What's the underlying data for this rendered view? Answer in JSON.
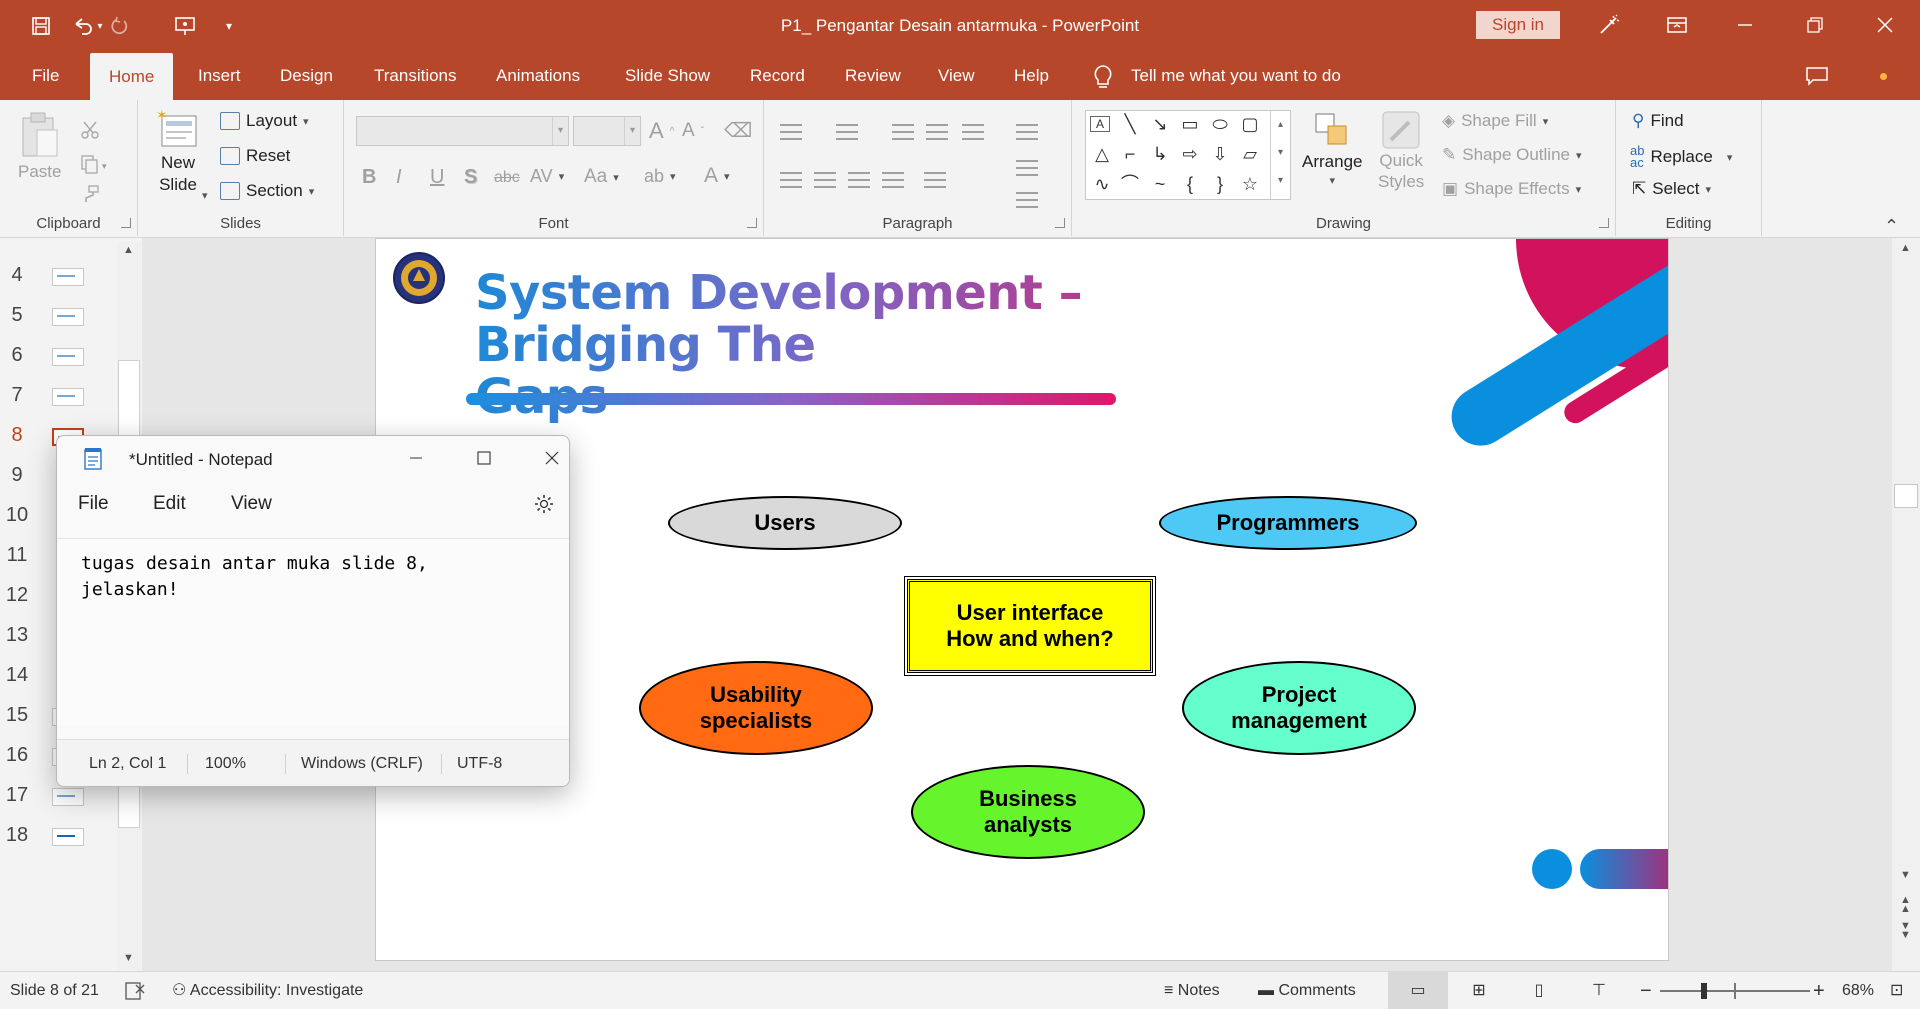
{
  "titlebar": {
    "document_title": "P1_ Pengantar Desain antarmuka  -  PowerPoint",
    "signin_label": "Sign in",
    "quick_access": [
      "save-icon",
      "undo-icon",
      "redo-icon",
      "present-icon",
      "customize-icon"
    ],
    "window_controls": [
      "ribbon-display-icon",
      "minimize-icon",
      "restore-icon",
      "close-icon"
    ]
  },
  "ribbon_tabs": [
    "File",
    "Home",
    "Insert",
    "Design",
    "Transitions",
    "Animations",
    "Slide Show",
    "Record",
    "Review",
    "View",
    "Help"
  ],
  "active_tab": "Home",
  "tell_me": "Tell me what you want to do",
  "ribbon": {
    "clipboard": {
      "label": "Clipboard",
      "paste": "Paste"
    },
    "slides": {
      "label": "Slides",
      "new_slide_line1": "New",
      "new_slide_line2": "Slide",
      "layout": "Layout",
      "reset": "Reset",
      "section": "Section"
    },
    "font": {
      "label": "Font",
      "buttons": [
        "B",
        "I",
        "U",
        "S",
        "abc",
        "AV",
        "Aa",
        "A"
      ]
    },
    "paragraph": {
      "label": "Paragraph"
    },
    "drawing": {
      "label": "Drawing",
      "arrange": "Arrange",
      "quick_styles_line1": "Quick",
      "quick_styles_line2": "Styles",
      "shape_fill": "Shape Fill",
      "shape_outline": "Shape Outline",
      "shape_effects": "Shape Effects"
    },
    "editing": {
      "label": "Editing",
      "find": "Find",
      "replace": "Replace",
      "select": "Select"
    }
  },
  "thumbnails": {
    "numbers": [
      "4",
      "5",
      "6",
      "7",
      "8",
      "9",
      "10",
      "11",
      "12",
      "13",
      "14",
      "15",
      "16",
      "17",
      "18"
    ],
    "active": "8"
  },
  "slide": {
    "title_line1": "System Development – Bridging The",
    "title_line2": "Gaps",
    "nodes": [
      {
        "id": "users",
        "text": "Users",
        "color": "#d9d9d9",
        "shape": "ellipse"
      },
      {
        "id": "programmers",
        "text": "Programmers",
        "color": "#4ec9f5",
        "shape": "ellipse"
      },
      {
        "id": "ui",
        "text": "User interface\nHow and when?",
        "color": "#ffff00",
        "shape": "rectangle"
      },
      {
        "id": "usability",
        "text": "Usability\nspecialists",
        "color": "#ff6a13",
        "shape": "ellipse"
      },
      {
        "id": "pm",
        "text": "Project\nmanagement",
        "color": "#64ffcc",
        "shape": "ellipse"
      },
      {
        "id": "business",
        "text": "Business\nanalysts",
        "color": "#66f52c",
        "shape": "ellipse"
      }
    ],
    "accent_colors": {
      "blue": "#0a8fdf",
      "pink": "#d3125e"
    }
  },
  "notepad": {
    "title": "*Untitled - Notepad",
    "menu": [
      "File",
      "Edit",
      "View"
    ],
    "content": "tugas desain antar muka slide 8,\njelaskan!",
    "status": {
      "position": "Ln 2, Col 1",
      "zoom": "100%",
      "line_ending": "Windows (CRLF)",
      "encoding": "UTF-8"
    }
  },
  "statusbar": {
    "slide_info": "Slide 8 of 21",
    "accessibility": "Accessibility: Investigate",
    "notes": "Notes",
    "comments": "Comments",
    "zoom": "68%"
  }
}
